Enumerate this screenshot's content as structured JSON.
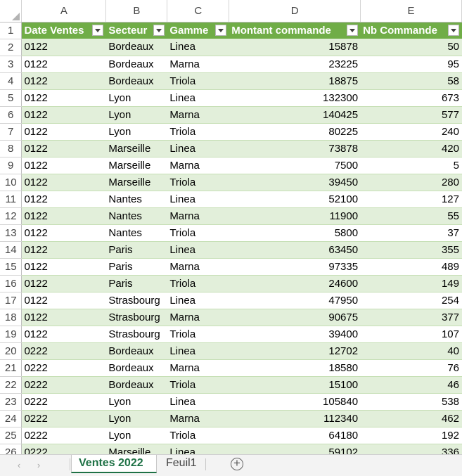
{
  "columns": [
    "A",
    "B",
    "C",
    "D",
    "E"
  ],
  "table_header": [
    "Date Ventes",
    "Secteur",
    "Gamme",
    "Montant commande",
    "Nb Commande"
  ],
  "rows": [
    [
      "0122",
      "Bordeaux",
      "Linea",
      "15878",
      "50"
    ],
    [
      "0122",
      "Bordeaux",
      "Marna",
      "23225",
      "95"
    ],
    [
      "0122",
      "Bordeaux",
      "Triola",
      "18875",
      "58"
    ],
    [
      "0122",
      "Lyon",
      "Linea",
      "132300",
      "673"
    ],
    [
      "0122",
      "Lyon",
      "Marna",
      "140425",
      "577"
    ],
    [
      "0122",
      "Lyon",
      "Triola",
      "80225",
      "240"
    ],
    [
      "0122",
      "Marseille",
      "Linea",
      "73878",
      "420"
    ],
    [
      "0122",
      "Marseille",
      "Marna",
      "7500",
      "5"
    ],
    [
      "0122",
      "Marseille",
      "Triola",
      "39450",
      "280"
    ],
    [
      "0122",
      "Nantes",
      "Linea",
      "52100",
      "127"
    ],
    [
      "0122",
      "Nantes",
      "Marna",
      "11900",
      "55"
    ],
    [
      "0122",
      "Nantes",
      "Triola",
      "5800",
      "37"
    ],
    [
      "0122",
      "Paris",
      "Linea",
      "63450",
      "355"
    ],
    [
      "0122",
      "Paris",
      "Marna",
      "97335",
      "489"
    ],
    [
      "0122",
      "Paris",
      "Triola",
      "24600",
      "149"
    ],
    [
      "0122",
      "Strasbourg",
      "Linea",
      "47950",
      "254"
    ],
    [
      "0122",
      "Strasbourg",
      "Marna",
      "90675",
      "377"
    ],
    [
      "0122",
      "Strasbourg",
      "Triola",
      "39400",
      "107"
    ],
    [
      "0222",
      "Bordeaux",
      "Linea",
      "12702",
      "40"
    ],
    [
      "0222",
      "Bordeaux",
      "Marna",
      "18580",
      "76"
    ],
    [
      "0222",
      "Bordeaux",
      "Triola",
      "15100",
      "46"
    ],
    [
      "0222",
      "Lyon",
      "Linea",
      "105840",
      "538"
    ],
    [
      "0222",
      "Lyon",
      "Marna",
      "112340",
      "462"
    ],
    [
      "0222",
      "Lyon",
      "Triola",
      "64180",
      "192"
    ],
    [
      "0222",
      "Marseille",
      "Linea",
      "59102",
      "336"
    ]
  ],
  "sheet_tabs": {
    "active": "Ventes 2022",
    "other": "Feuil1",
    "prev_icon": "chevron-left-icon",
    "next_icon": "chevron-right-icon",
    "add_icon": "plus-circle-icon"
  },
  "colors": {
    "header_fill": "#70ad47",
    "band_fill": "#e2efda",
    "active_tab_text": "#1e7145"
  }
}
